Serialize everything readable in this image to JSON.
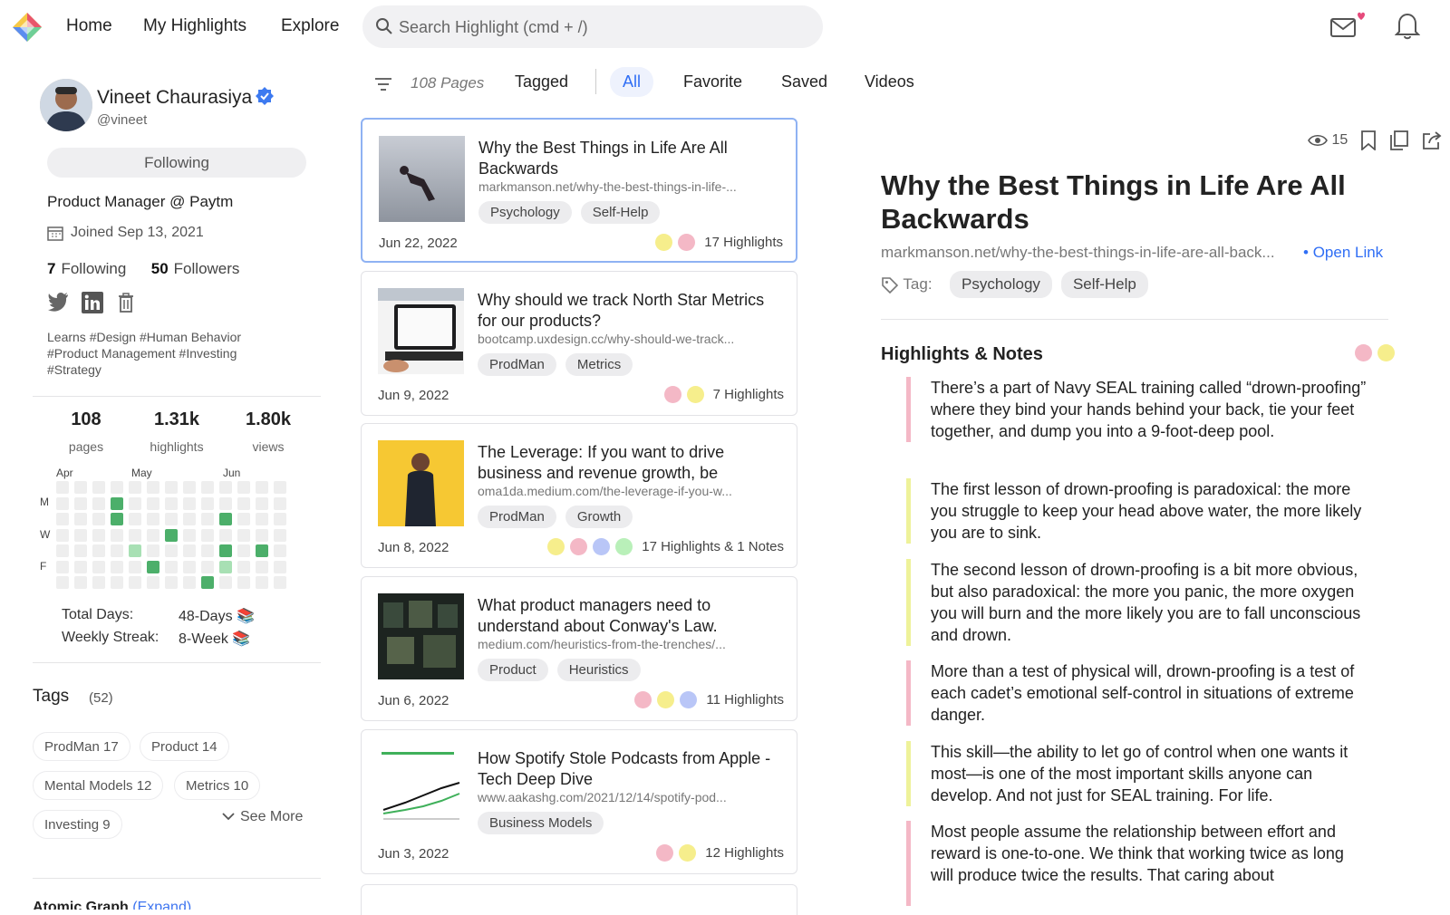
{
  "nav": {
    "links": [
      "Home",
      "My Highlights",
      "Explore"
    ],
    "search_placeholder": "Search Highlight (cmd + /)",
    "icons": [
      "mail-icon",
      "bell-icon"
    ]
  },
  "profile": {
    "name": "Vineet Chaurasiya",
    "handle": "@vineet",
    "follow_button": "Following",
    "role": "Product Manager @ Paytm",
    "joined": "Joined Sep 13, 2021",
    "following_count": "7",
    "following_label": "Following",
    "followers_count": "50",
    "followers_label": "Followers",
    "bio": "Learns #Design #Human Behavior #Product Management #Investing #Strategy",
    "stats": [
      {
        "value": "108",
        "label": "pages"
      },
      {
        "value": "1.31k",
        "label": "highlights"
      },
      {
        "value": "1.80k",
        "label": "views"
      }
    ],
    "heatmap": {
      "months": [
        "Apr",
        "May",
        "Jun"
      ],
      "days": [
        "M",
        "W",
        "F"
      ]
    },
    "total_days_label": "Total Days:",
    "total_days_value": "48-Days 📚",
    "weekly_streak_label": "Weekly Streak:",
    "weekly_streak_value": "8-Week 📚"
  },
  "tags": {
    "title": "Tags",
    "count": "(52)",
    "items": [
      "ProdMan 17",
      "Product 14",
      "Mental Models 12",
      "Metrics 10",
      "Investing 9"
    ],
    "see_more": "See More"
  },
  "atomic": {
    "title": "Atomic Graph",
    "expand": "(Expand)"
  },
  "list": {
    "pages_count": "108 Pages",
    "tabs": [
      "Tagged",
      "All",
      "Favorite",
      "Saved",
      "Videos"
    ],
    "active_tab": "All",
    "cards": [
      {
        "title": "Why the Best Things in Life Are All Backwards",
        "url": "markmanson.net/why-the-best-things-in-life-...",
        "tags": [
          "Psychology",
          "Self-Help"
        ],
        "date": "Jun 22, 2022",
        "dots": [
          "#f6ee8c",
          "#f4b8c6"
        ],
        "highlights": "17 Highlights"
      },
      {
        "title": "Why should we track North Star Metrics for our products?",
        "url": "bootcamp.uxdesign.cc/why-should-we-track...",
        "tags": [
          "ProdMan",
          "Metrics"
        ],
        "date": "Jun 9, 2022",
        "dots": [
          "#f4b8c6",
          "#f6ee8c"
        ],
        "highlights": "7 Highlights"
      },
      {
        "title": "The Leverage: If you want to drive business and revenue growth, be",
        "url": "oma1da.medium.com/the-leverage-if-you-w...",
        "tags": [
          "ProdMan",
          "Growth"
        ],
        "date": "Jun 8, 2022",
        "dots": [
          "#f6ee8c",
          "#f4b8c6",
          "#b9c6f7",
          "#b9f0b9"
        ],
        "highlights": "17 Highlights & 1 Notes"
      },
      {
        "title": "What product managers need to understand about Conway's Law.",
        "url": "medium.com/heuristics-from-the-trenches/...",
        "tags": [
          "Product",
          "Heuristics"
        ],
        "date": "Jun 6, 2022",
        "dots": [
          "#f4b8c6",
          "#f6ee8c",
          "#b9c6f7"
        ],
        "highlights": "11 Highlights"
      },
      {
        "title": "How Spotify Stole Podcasts from Apple - Tech Deep Dive",
        "url": "www.aakashg.com/2021/12/14/spotify-pod...",
        "tags": [
          "Business Models"
        ],
        "date": "Jun 3, 2022",
        "dots": [
          "#f4b8c6",
          "#f6ee8c"
        ],
        "highlights": "12 Highlights"
      }
    ]
  },
  "detail": {
    "views": "15",
    "title": "Why the Best Things in Life Are All Backwards",
    "url": "markmanson.net/why-the-best-things-in-life-are-all-back...",
    "open_link": "Open Link",
    "tag_label": "Tag:",
    "tags": [
      "Psychology",
      "Self-Help"
    ],
    "section_title": "Highlights & Notes",
    "header_dots": [
      "#f4b8c6",
      "#f6ee8c"
    ],
    "highlights": [
      {
        "text": "There’s a part of Navy SEAL training called “drown-proofing” where they bind your hands behind your back, tie your feet together, and dump you into a 9-foot-deep pool.",
        "color": "#f4b8c6"
      },
      {
        "text": "The first lesson of drown-proofing is paradoxical: the more you struggle to keep your head above water, the more likely you are to sink.",
        "color": "#eef29a"
      },
      {
        "text": "The second lesson of drown-proofing is a bit more obvious, but also paradoxical: the more you panic, the more oxygen you will burn and the more likely you are to fall unconscious and drown.",
        "color": "#eef29a"
      },
      {
        "text": "More than a test of physical will, drown-proofing is a test of each cadet’s emotional self-control in situations of extreme danger.",
        "color": "#f4b8c6"
      },
      {
        "text": "This skill—the ability to let go of control when one wants it most—is one of the most important skills anyone can develop. And not just for SEAL training. For life.",
        "color": "#eef29a"
      },
      {
        "text": "Most people assume the relationship between effort and reward is one-to-one. We think that working twice as long will produce twice the results. That caring about",
        "color": "#f4b8c6"
      }
    ]
  },
  "colors": {
    "accent": "#2f6ef5",
    "heat_dark": "#4caf6a",
    "heat_light": "#a8e0b4"
  }
}
